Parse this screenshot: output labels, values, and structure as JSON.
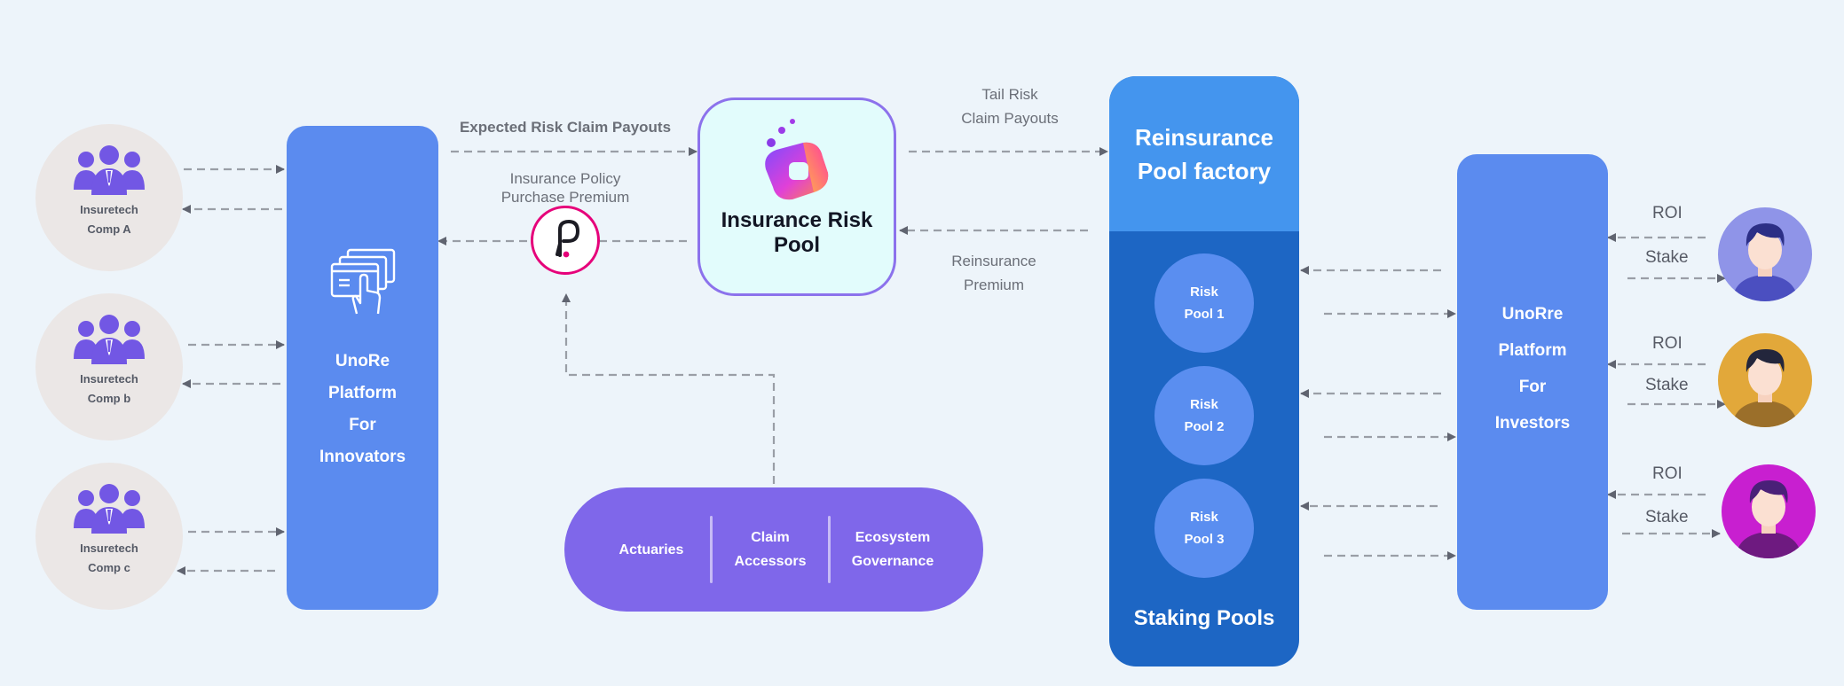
{
  "companies": [
    {
      "line1": "Insuretech",
      "line2": "Comp A"
    },
    {
      "line1": "Insuretech",
      "line2": "Comp b"
    },
    {
      "line1": "Insuretech",
      "line2": "Comp c"
    }
  ],
  "innovators_platform": [
    "UnoRe",
    "Platform",
    "For",
    "Innovators"
  ],
  "labels": {
    "expected_payouts": "Expected Risk Claim Payouts",
    "premium_line1": "Insurance Policy",
    "premium_line2": "Purchase Premium",
    "tail_line1": "Tail Risk",
    "tail_line2": "Claim Payouts",
    "reins_line1": "Reinsurance",
    "reins_line2": "Premium"
  },
  "insurance_pool": {
    "line1": "Insurance Risk",
    "line2": "Pool"
  },
  "roles": {
    "actuaries": "Actuaries",
    "claim_line1": "Claim",
    "claim_line2": "Accessors",
    "eco_line1": "Ecosystem",
    "eco_line2": "Governance"
  },
  "staking": {
    "factory_line1": "Reinsurance",
    "factory_line2": "Pool factory",
    "pools": [
      {
        "line1": "Risk",
        "line2": "Pool 1"
      },
      {
        "line1": "Risk",
        "line2": "Pool 2"
      },
      {
        "line1": "Risk",
        "line2": "Pool 3"
      }
    ],
    "footer": "Staking Pools"
  },
  "investors_platform": [
    "UnoRre",
    "Platform",
    "For",
    "Investors"
  ],
  "investor_flows": {
    "roi": "ROI",
    "stake": "Stake"
  },
  "icons": {
    "company": "group-people-icon",
    "platform": "touch-screen-windows-icon",
    "token": "polkadot-logo-icon",
    "pool": "colorful-cube-logo-icon",
    "investor": "user-avatar-icon"
  },
  "colors": {
    "background": "#edf4fa",
    "platform_blue": "#5b8bef",
    "purple": "#7f67ea",
    "staking_dark": "#1d66c4",
    "staking_light": "#4495ee",
    "avatar_1": "#8f94e8",
    "avatar_2": "#e2a83a",
    "avatar_3": "#c81fd0",
    "polkadot_pink": "#e6007a"
  }
}
